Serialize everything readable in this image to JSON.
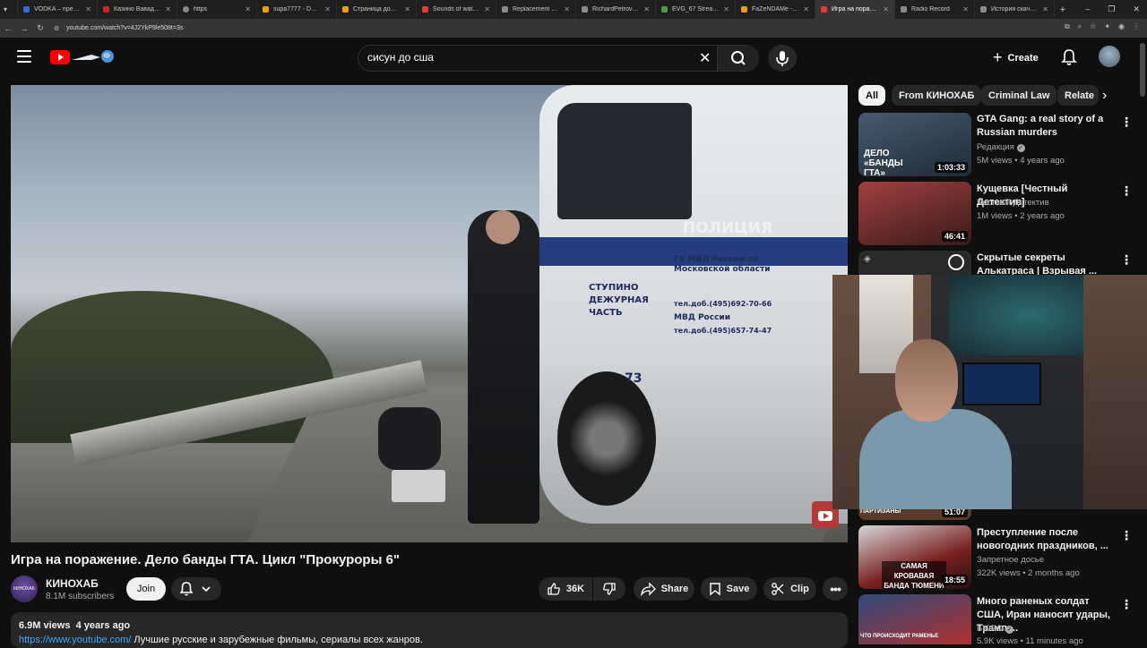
{
  "browser": {
    "tabs": [
      {
        "label": "VODKA – премиум",
        "color": "#2f6fd6"
      },
      {
        "label": "Казино Вавада — ...",
        "color": "#c62828"
      },
      {
        "label": "https",
        "color": "#8a8a8a"
      },
      {
        "label": "supa7777 - Donatio",
        "color": "#f39c12"
      },
      {
        "label": "Страница донатов",
        "color": "#f39c12"
      },
      {
        "label": "Sounds of water fo",
        "color": "#e53935"
      },
      {
        "label": "Replacement Parts",
        "color": "#8a8a8a"
      },
      {
        "label": "RichardPetrovich - ",
        "color": "#8a8a8a"
      },
      {
        "label": "EVG_67 Stream - Vi",
        "color": "#43a047"
      },
      {
        "label": "FaZeNDAMe - Dona",
        "color": "#f39c12"
      },
      {
        "label": "Игра на пораж...",
        "color": "#e53935",
        "active": true
      },
      {
        "label": "Radio Record",
        "color": "#8a8a8a"
      },
      {
        "label": "История скачиван",
        "color": "#8a8a8a"
      }
    ],
    "new_tab": "+",
    "url": "youtube.com/watch?v=4J2YkP9le508t=3s"
  },
  "header": {
    "search_query": "сисун до сша",
    "create_label": "Create"
  },
  "video": {
    "title": "Игра на поражение. Дело банды ГТА. Цикл \"Прокуроры 6\"",
    "overlay_text": {
      "police": "ПОЛИЦИЯ",
      "dept": "ГУ МВД России по Московской области",
      "duty": "СТУПИНО ДЕЖУРНАЯ ЧАСТЬ",
      "phone1": "тел.доб.(495)692-70-66",
      "mvd": "МВД России",
      "phone2": "тел.доб.(495)657-74-47",
      "number": "73"
    },
    "channel_name": "КИНОХАБ",
    "channel_avatar_text": "КИНОХАБ",
    "subscribers": "8.1M subscribers",
    "join_label": "Join",
    "likes": "36K",
    "share_label": "Share",
    "save_label": "Save",
    "clip_label": "Clip",
    "views": "6.9M views",
    "age": "4 years ago",
    "desc_link": "https://www.youtube.com/",
    "desc_text": " Лучшие русские и зарубежные фильмы, сериалы всех жанров."
  },
  "chips": [
    "All",
    "From КИНОХАБ",
    "Criminal Law",
    "Relate"
  ],
  "recommendations": [
    {
      "title": "GTA Gang: a real story of a Russian murders",
      "channel": "Редакция",
      "verified": true,
      "meta": "5M views • 4 years ago",
      "duration": "1:03:33",
      "thumb_text": "ДЕЛО «БАНДЫ ГТА»",
      "thumb_color": "#3a4a5a"
    },
    {
      "title": "Кущевка [Честный Детектив]",
      "channel": "Честный Детектив",
      "verified": false,
      "meta": "1M views • 2 years ago",
      "duration": "46:41",
      "thumb_text": "",
      "thumb_color": "#7a3030"
    },
    {
      "title": "Скрытые секреты Алькатраса | Взрывая ...",
      "channel": "",
      "verified": false,
      "meta": "",
      "duration": "",
      "thumb_text": "",
      "thumb_color": "#2a2a2a"
    },
    {
      "title": "",
      "channel": "",
      "verified": false,
      "meta": "",
      "duration": "51:07",
      "thumb_text": "ПАРТИЗАНЫ",
      "thumb_color": "#5a3a2a"
    },
    {
      "title": "Преступление после новогодних праздников, ...",
      "channel": "Запретное досье",
      "verified": false,
      "meta": "322K views • 2 months ago",
      "duration": "18:55",
      "thumb_text": "САМАЯ КРОВАВАЯ БАНДА ТЮМЕНИ",
      "thumb_color": "#6a2020"
    },
    {
      "title": "Много раненых солдат США, Иран наносит удары, Трамп ...",
      "channel": "БЮРО",
      "verified": true,
      "meta": "5.9K views • 11 minutes ago",
      "duration": "",
      "thumb_text": "ЧТО ПРОИСХОДИТ РАМЕНЬЕ",
      "thumb_color": "#243a5a"
    }
  ]
}
